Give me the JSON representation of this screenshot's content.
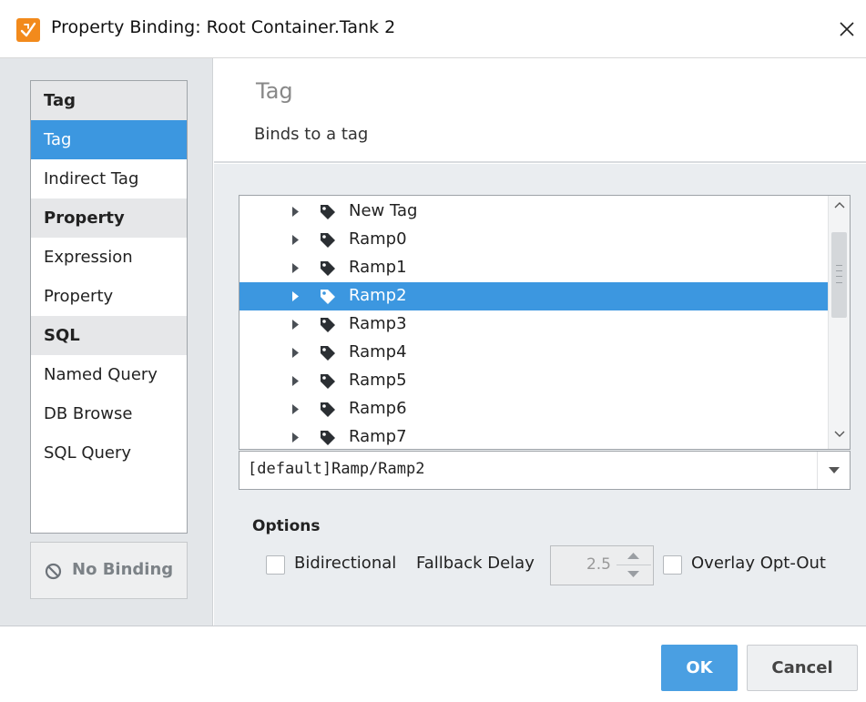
{
  "window": {
    "title": "Property Binding: Root Container.Tank 2"
  },
  "colors": {
    "accent": "#3c97e0",
    "app_icon": "#f28a1c"
  },
  "binding_types": {
    "groups": [
      {
        "header": "Tag",
        "items": [
          "Tag",
          "Indirect Tag"
        ]
      },
      {
        "header": "Property",
        "items": [
          "Expression",
          "Property"
        ]
      },
      {
        "header": "SQL",
        "items": [
          "Named Query",
          "DB Browse",
          "SQL Query"
        ]
      }
    ],
    "selected": "Tag",
    "no_binding_label": "No Binding"
  },
  "binding_header": {
    "title": "Tag",
    "description": "Binds to a tag"
  },
  "tag_tree": {
    "items": [
      "New Tag",
      "Ramp0",
      "Ramp1",
      "Ramp2",
      "Ramp3",
      "Ramp4",
      "Ramp5",
      "Ramp6",
      "Ramp7"
    ],
    "selected": "Ramp2"
  },
  "tag_path": "[default]Ramp/Ramp2",
  "options": {
    "title": "Options",
    "bidirectional_label": "Bidirectional",
    "bidirectional_checked": false,
    "fallback_delay_label": "Fallback Delay",
    "fallback_delay_value": "2.5",
    "overlay_optout_label": "Overlay Opt-Out",
    "overlay_optout_checked": false
  },
  "footer": {
    "ok_label": "OK",
    "cancel_label": "Cancel"
  }
}
